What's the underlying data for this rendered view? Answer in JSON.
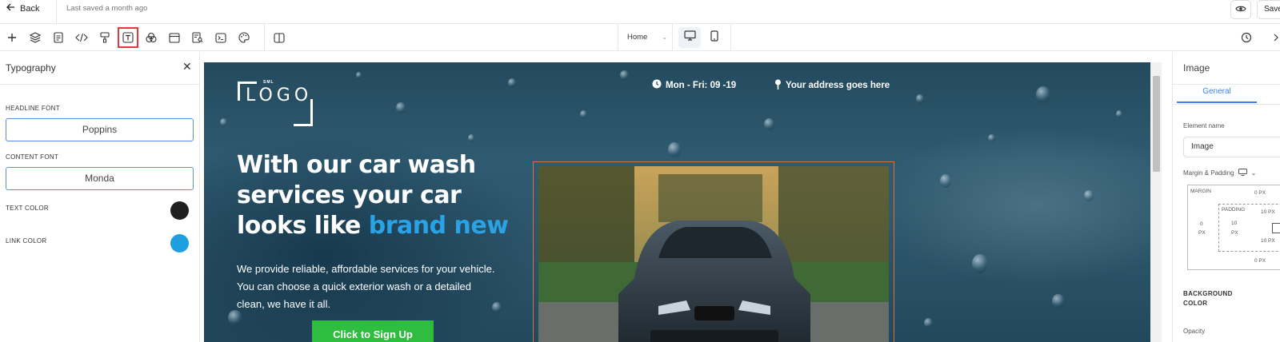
{
  "topbar": {
    "back_label": "Back",
    "last_saved": "Last saved a month ago",
    "save_label": "Save"
  },
  "toolbar": {
    "page_select": "Home"
  },
  "left_panel": {
    "title": "Typography",
    "headline_font_label": "HEADLINE FONT",
    "headline_font_value": "Poppins",
    "content_font_label": "CONTENT FONT",
    "content_font_value": "Monda",
    "text_color_label": "TEXT COLOR",
    "text_color": "#1f1f1f",
    "link_color_label": "LINK COLOR",
    "link_color": "#1e9fe0"
  },
  "canvas": {
    "logo_small": "SML",
    "logo_text": "LOGO",
    "hours": "Mon - Fri: 09 -19",
    "address": "Your address goes here",
    "headline_part1": "With our car wash services your car looks like ",
    "headline_accent": "brand new",
    "paragraph": "We provide reliable, affordable services for your vehicle. You can choose a quick exterior wash or a detailed clean, we have it all.",
    "cta_label": "Click to Sign Up",
    "accent_color": "#2aa3e6",
    "cta_color": "#2ebd3e"
  },
  "right_panel": {
    "title": "Image",
    "tab_general": "General",
    "element_name_label": "Element name",
    "element_name_value": "Image",
    "margin_padding_label": "Margin & Padding",
    "margin_label": "MARGIN",
    "padding_label": "PADDING",
    "margin_top": "0 PX",
    "margin_left_value": "0",
    "margin_left_unit": "PX",
    "margin_bottom": "0 PX",
    "padding_top": "10 PX",
    "padding_left_value": "10",
    "padding_left_unit": "PX",
    "padding_bottom": "10 PX",
    "background_color_label": "BACKGROUND COLOR",
    "opacity_label": "Opacity"
  }
}
